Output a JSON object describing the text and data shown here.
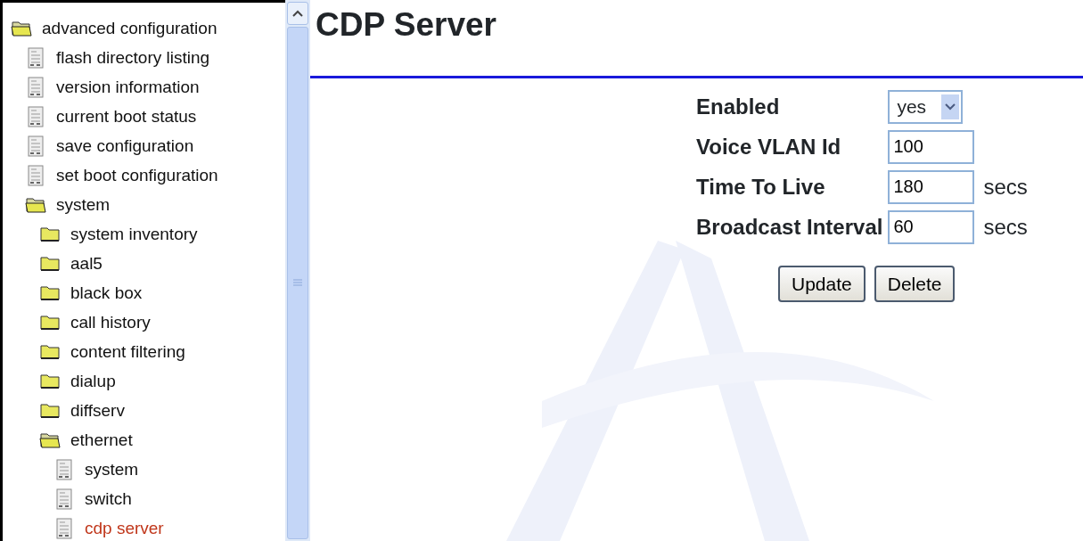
{
  "tree": [
    {
      "kind": "folder",
      "label": "advanced configuration",
      "expanded": true,
      "selected": false,
      "children": [
        {
          "kind": "page",
          "label": "flash directory listing",
          "selected": false
        },
        {
          "kind": "page",
          "label": "version information",
          "selected": false
        },
        {
          "kind": "page",
          "label": "current boot status",
          "selected": false
        },
        {
          "kind": "page",
          "label": "save configuration",
          "selected": false
        },
        {
          "kind": "page",
          "label": "set boot configuration",
          "selected": false
        },
        {
          "kind": "folder",
          "label": "system",
          "expanded": true,
          "selected": false,
          "children": [
            {
              "kind": "folder",
              "label": "system inventory",
              "expanded": false,
              "selected": false
            },
            {
              "kind": "folder",
              "label": "aal5",
              "expanded": false,
              "selected": false
            },
            {
              "kind": "folder",
              "label": "black box",
              "expanded": false,
              "selected": false
            },
            {
              "kind": "folder",
              "label": "call history",
              "expanded": false,
              "selected": false
            },
            {
              "kind": "folder",
              "label": "content filtering",
              "expanded": false,
              "selected": false
            },
            {
              "kind": "folder",
              "label": "dialup",
              "expanded": false,
              "selected": false
            },
            {
              "kind": "folder",
              "label": "diffserv",
              "expanded": false,
              "selected": false
            },
            {
              "kind": "folder",
              "label": "ethernet",
              "expanded": true,
              "selected": false,
              "children": [
                {
                  "kind": "page",
                  "label": "system",
                  "selected": false
                },
                {
                  "kind": "page",
                  "label": "switch",
                  "selected": false
                },
                {
                  "kind": "page",
                  "label": "cdp server",
                  "selected": true
                }
              ]
            }
          ]
        }
      ]
    }
  ],
  "page": {
    "title": "CDP Server",
    "fields": [
      {
        "kind": "select",
        "label": "Enabled",
        "value": "yes"
      },
      {
        "kind": "text",
        "label": "Voice VLAN Id",
        "value": "100"
      },
      {
        "kind": "text",
        "label": "Time To Live",
        "value": "180",
        "unit": "secs"
      },
      {
        "kind": "text",
        "label": "Broadcast Interval",
        "value": "60",
        "unit": "secs"
      }
    ],
    "buttons": [
      "Update",
      "Delete"
    ]
  }
}
